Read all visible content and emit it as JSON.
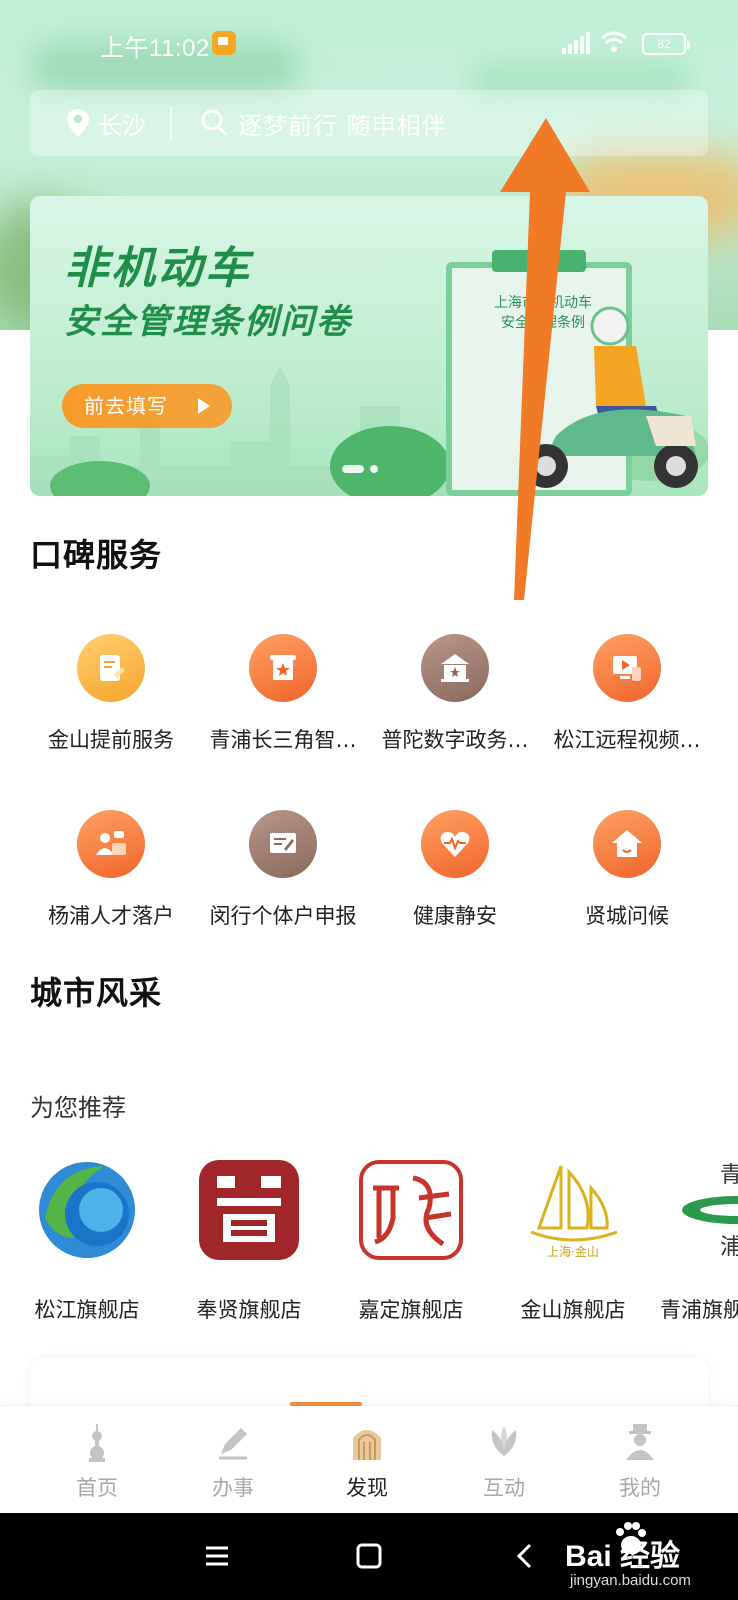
{
  "status_bar": {
    "time": "上午11:02",
    "battery": "82"
  },
  "header": {
    "location": "长沙",
    "search_placeholder": "逐梦前行 随申相伴"
  },
  "banner": {
    "title": "非机动车",
    "subtitle": "安全管理条例问卷",
    "button_label": "前去填写",
    "clipboard_line1": "上海市非机动车",
    "clipboard_line2": "安全管理条例"
  },
  "services": {
    "title": "口碑服务",
    "items": [
      {
        "label": "金山提前服务",
        "icon": "document-pen-icon"
      },
      {
        "label": "青浦长三角智…",
        "icon": "award-banner-icon"
      },
      {
        "label": "普陀数字政务…",
        "icon": "government-building-icon"
      },
      {
        "label": "松江远程视频…",
        "icon": "video-play-icon"
      },
      {
        "label": "杨浦人才落户",
        "icon": "person-id-icon"
      },
      {
        "label": "闵行个体户申报",
        "icon": "form-edit-icon"
      },
      {
        "label": "健康静安",
        "icon": "heart-pulse-icon"
      },
      {
        "label": "贤城问候",
        "icon": "home-icon"
      }
    ]
  },
  "city": {
    "title": "城市风采",
    "recommend_title": "为您推荐",
    "stores": [
      {
        "label": "松江旗舰店",
        "icon": "songjiang-logo-icon"
      },
      {
        "label": "奉贤旗舰店",
        "icon": "fengxian-seal-icon"
      },
      {
        "label": "嘉定旗舰店",
        "icon": "jiading-seal-icon"
      },
      {
        "label": "金山旗舰店",
        "icon": "jinshan-sail-logo-icon"
      },
      {
        "label": "青浦旗舰店",
        "icon": "qingpu-logo-icon"
      }
    ]
  },
  "tab_bar": {
    "tabs": [
      {
        "label": "首页",
        "icon": "tower-icon"
      },
      {
        "label": "办事",
        "icon": "pen-icon"
      },
      {
        "label": "发现",
        "icon": "arch-icon"
      },
      {
        "label": "互动",
        "icon": "magnolia-icon"
      },
      {
        "label": "我的",
        "icon": "person-icon"
      }
    ],
    "active_index": 2,
    "active_color": "#f08a3c"
  },
  "watermark": {
    "brand": "Bai 经验",
    "site": "jingyan.baidu.com"
  },
  "colors": {
    "accent_orange": "#f08a3c",
    "banner_green": "#1f8e48"
  }
}
